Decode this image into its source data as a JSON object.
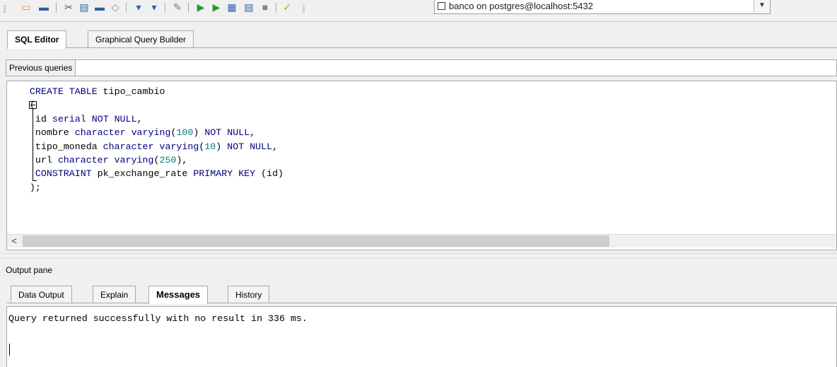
{
  "toolbar": {
    "connection": "banco on postgres@localhost:5432",
    "icons": [
      "open-folder-icon",
      "save-icon",
      "cut-icon",
      "copy-icon",
      "paste-icon",
      "clear-icon",
      "find-icon",
      "replace-icon",
      "edit-icon",
      "execute-icon",
      "execute-pgscript-icon",
      "execute-to-file-icon",
      "explain-icon",
      "cancel-icon",
      "help-icon"
    ]
  },
  "tabs": {
    "sql_editor": "SQL Editor",
    "graphical_query_builder": "Graphical Query Builder"
  },
  "previous_queries": {
    "label": "Previous queries"
  },
  "editor": {
    "lines": [
      [
        "CREATE TABLE tipo_cambio"
      ],
      [
        "("
      ],
      [
        "id serial NOT NULL,"
      ],
      [
        "nombre character varying(100) NOT NULL,"
      ],
      [
        "tipo_moneda character varying(10) NOT NULL,"
      ],
      [
        "url character varying(250),"
      ],
      [
        "CONSTRAINT pk_exchange_rate PRIMARY KEY (id)"
      ],
      [
        ");"
      ]
    ],
    "scroll_left_arrow": "<"
  },
  "output": {
    "title": "Output pane",
    "tabs": [
      "Data Output",
      "Explain",
      "Messages",
      "History"
    ],
    "active_tab": "Messages",
    "message": "Query returned successfully with no result in 336 ms."
  }
}
